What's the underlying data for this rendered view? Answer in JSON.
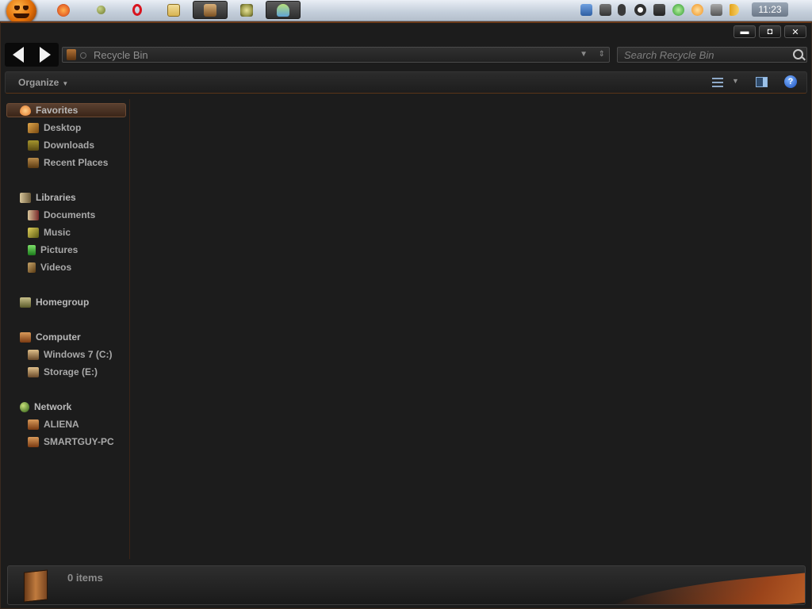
{
  "taskbar": {
    "start_icon": "pumpkin-orb-icon",
    "buttons": [
      {
        "icon": "firefox-icon",
        "color": "#e8682a",
        "active": false
      },
      {
        "icon": "ball-icon",
        "color": "#6e7a2c",
        "active": false
      },
      {
        "icon": "opera-icon",
        "color": "#d8141e",
        "active": false
      },
      {
        "icon": "windows-stack-icon",
        "color": "#d8b451",
        "active": false
      },
      {
        "icon": "explorer-folder-icon",
        "color": "#b98a4f",
        "active": true
      },
      {
        "icon": "app-disc-icon",
        "color": "#9c9b4a",
        "active": false
      },
      {
        "icon": "messenger-icon",
        "color": "#5fa3d6",
        "active": true
      }
    ],
    "tray_icons": [
      {
        "icon": "monitor-app-icon",
        "color": "#2f5fa3"
      },
      {
        "icon": "usb-icon",
        "color": "#444444"
      },
      {
        "icon": "bluetooth-icon",
        "color": "#333333"
      },
      {
        "icon": "network-globe-icon",
        "color": "#303030"
      },
      {
        "icon": "camera-icon",
        "color": "#333333"
      },
      {
        "icon": "green-status-icon",
        "color": "#2e9a2e"
      },
      {
        "icon": "orange-clock-icon",
        "color": "#f0901c"
      },
      {
        "icon": "display-icon",
        "color": "#555555"
      },
      {
        "icon": "volume-icon",
        "color": "#e2a11a"
      }
    ],
    "clock": "11:23"
  },
  "window": {
    "address": {
      "text": "Recycle Bin",
      "icon": "recycle-bin-icon"
    },
    "search": {
      "placeholder": "Search Recycle Bin"
    },
    "toolbar": {
      "organize_label": "Organize"
    },
    "navigation": {
      "favorites_label": "Favorites",
      "favorites": [
        "Desktop",
        "Downloads",
        "Recent Places"
      ],
      "libraries_label": "Libraries",
      "libraries": [
        "Documents",
        "Music",
        "Pictures",
        "Videos"
      ],
      "homegroup_label": "Homegroup",
      "computer_label": "Computer",
      "drives": [
        "Windows 7 (C:)",
        "Storage (E:)"
      ],
      "network_label": "Network",
      "network_computers": [
        "ALIENA",
        "SMARTGUY-PC"
      ]
    },
    "status": {
      "text": "0 items"
    }
  },
  "colors": {
    "accent": "#a8481a",
    "window_bg": "#1c1c1c",
    "nav_text": "#a9a9a9"
  }
}
